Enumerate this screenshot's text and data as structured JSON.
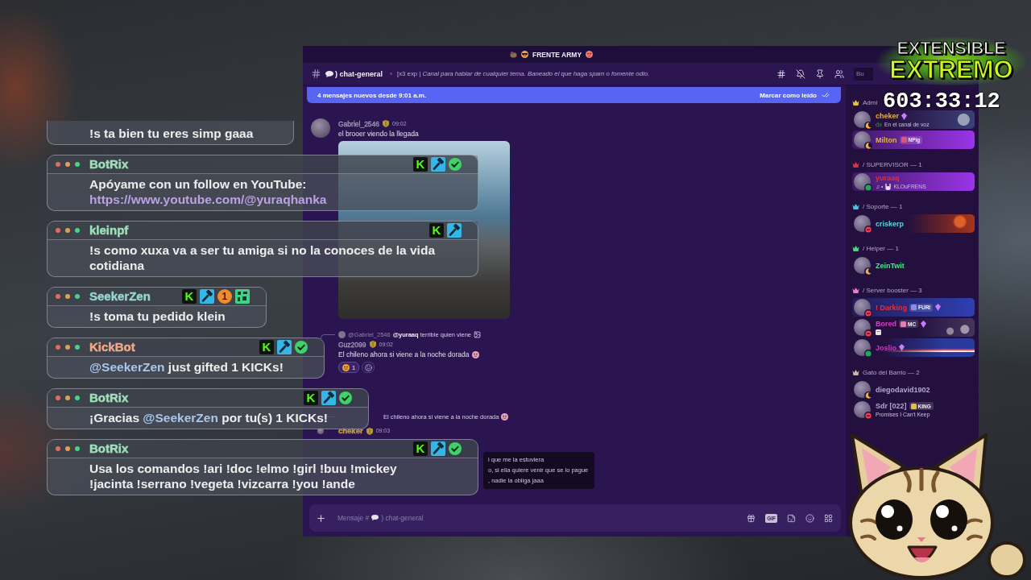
{
  "logo": {
    "lines": [
      "EXTENSIBLE",
      "EXTREMO"
    ]
  },
  "timer": "603:33:12",
  "stream_chat": [
    {
      "text": [
        {
          "kind": "plain",
          "text": "!s ta bien tu eres simp gaaa"
        }
      ]
    },
    {
      "user": "BotRix",
      "color": "#9fe0bb",
      "badges": [
        {
          "kind": "kick",
          "label": "K"
        },
        {
          "kind": "mod"
        },
        {
          "kind": "verified"
        }
      ],
      "text": [
        {
          "kind": "plain",
          "text": "Apóyame con un follow en YouTube:"
        },
        {
          "kind": "link",
          "text": "https://www.youtube.com/@yuraqhanka"
        }
      ]
    },
    {
      "user": "kleinpf",
      "color": "#9fe0bb",
      "badges": [
        {
          "kind": "kick",
          "label": "K"
        },
        {
          "kind": "mod"
        }
      ],
      "text": [
        {
          "kind": "plain",
          "text": "!s como xuxa va a ser tu amiga si no la conoces de la vida cotidiana"
        }
      ]
    },
    {
      "user": "SeekerZen",
      "color": "#97d6cf",
      "badges": [
        {
          "kind": "kick",
          "label": "K"
        },
        {
          "kind": "mod"
        },
        {
          "kind": "coin",
          "label": "1"
        },
        {
          "kind": "pixel"
        }
      ],
      "text": [
        {
          "kind": "plain",
          "text": "!s toma tu pedido klein"
        }
      ]
    },
    {
      "user": "KickBot",
      "color": "#f0a98a",
      "badges": [
        {
          "kind": "kick",
          "label": "K"
        },
        {
          "kind": "mod"
        },
        {
          "kind": "verified"
        }
      ],
      "text": [
        {
          "kind": "mention",
          "text": "@SeekerZen"
        },
        {
          "kind": "plain",
          "text": " just gifted 1 KICKs!"
        }
      ]
    },
    {
      "user": "BotRix",
      "color": "#9fe0bb",
      "badges": [
        {
          "kind": "kick",
          "label": "K"
        },
        {
          "kind": "mod"
        },
        {
          "kind": "verified"
        }
      ],
      "text": [
        {
          "kind": "plain",
          "text": "¡Gracias "
        },
        {
          "kind": "mention",
          "text": "@SeekerZen"
        },
        {
          "kind": "plain",
          "text": " por tu(s) 1 KICKs!"
        }
      ]
    },
    {
      "user": "BotRix",
      "color": "#9fe0bb",
      "badges": [
        {
          "kind": "kick",
          "label": "K"
        },
        {
          "kind": "mod"
        },
        {
          "kind": "verified"
        }
      ],
      "text": [
        {
          "kind": "plain",
          "text": "Usa los comandos !ari !doc !elmo !girl !buu !mickey !jacinta !serrano !vegeta !vizcarra !you !ande"
        }
      ]
    }
  ],
  "discord": {
    "server": {
      "title": "FRENTE ARMY"
    },
    "channel": {
      "name": ") chat-general",
      "topic": "[x3 exp | *Canal para hablar de cualquier tema. Baneado el que haga spam o fomente odio.*"
    },
    "search": {
      "placeholder": "Bu"
    },
    "new_messages": {
      "text": "4 mensajes nuevos desde 9:01 a.m.",
      "action": "Marcar como leído"
    },
    "messages": [
      {
        "author": "Gabriel_2546",
        "color": "#a79cbb",
        "avatar": true,
        "time": "09:02",
        "text": "el brooer viendo la llegada",
        "emoji": false,
        "attachment": {
          "kind": "photo"
        }
      },
      {
        "reply": {
          "author": "@Gabriel_2546",
          "text": "**@yuraaq** terrible quien viene",
          "image": true,
          "emoji": false
        },
        "author": "Guz2099",
        "color": "#a79cbb",
        "avatar": false,
        "time": "09:02",
        "text": "El chileno ahora si viene a la noche dorada",
        "emoji": true,
        "reactions": [
          {
            "count": "1"
          }
        ]
      },
      {
        "reply": {
          "text": "El chileno ahora si viene a la noche dorada",
          "image": false,
          "emoji": true
        },
        "author": "cheker",
        "color": "#c29d3c",
        "avatar": true,
        "time": "09:03",
        "embed_lines": [
          "i que me la estuviera",
          "o, si ella quiere venir que se lo pague",
          ", nadie la obliga jaaa"
        ]
      }
    ],
    "composer": {
      "placeholder": [
        "Mensaje #",
        ") chat-general"
      ],
      "gif": "GIF"
    },
    "member_groups": [
      {
        "title": "Admi",
        "color": "#e8c13a",
        "members": [
          {
            "name": "cheker",
            "color": "#e3b341",
            "status": {
              "kind": "idle"
            },
            "boosting": true,
            "nameplate": {
              "kind": "moon"
            },
            "subtitle": {
              "kind": "voice",
              "text": "En el canal de voz"
            }
          },
          {
            "name": "Milton",
            "color": "#e3b341",
            "status": {
              "kind": "idle"
            },
            "boosting": false,
            "nameplate": {
              "kind": "violet"
            },
            "tag": {
              "label": "NPig",
              "color": "#e0557a"
            }
          }
        ]
      },
      {
        "title": "/ SUPERVISOR — 1",
        "color": "#e0303a",
        "members": [
          {
            "name": "yuraaq",
            "color": "#e0303a",
            "status": {
              "kind": "online"
            },
            "boosting": false,
            "nameplate": {
              "kind": "violet"
            },
            "subtitle": {
              "kind": "activity",
              "prefix": "♫ •",
              "text": "KLOuFRENS"
            }
          }
        ]
      },
      {
        "title": "/ Soporte — 1",
        "color": "#3ec7e0",
        "members": [
          {
            "name": "criskerp",
            "color": "#5fd3e0",
            "status": {
              "kind": "dnd"
            },
            "boosting": false,
            "nameplate": {
              "kind": "fire"
            }
          }
        ]
      },
      {
        "title": "/ Helper — 1",
        "color": "#3ee07a",
        "members": [
          {
            "name": "ZeinTwit",
            "color": "#4ee08a",
            "status": {
              "kind": "idle"
            },
            "boosting": false
          }
        ]
      },
      {
        "title": "/ Server booster — 3",
        "color": "#f07ad0",
        "members": [
          {
            "name": "! Darking",
            "color": "#e0303a",
            "status": {
              "kind": "dnd"
            },
            "boosting": true,
            "nameplate": {
              "kind": "ocean"
            },
            "tag": {
              "label": "FURI",
              "color": "#8a8cf0"
            }
          },
          {
            "name": "Bored",
            "color": "#d63fbf",
            "status": {
              "kind": "dnd"
            },
            "boosting": true,
            "nameplate": {
              "kind": "flowers"
            },
            "tag": {
              "label": "MC",
              "color": "#f07ab0"
            },
            "subtitle": {
              "kind": "emoji"
            }
          },
          {
            "name": "Joslio",
            "color": "#c03fc0",
            "status": {
              "kind": "online"
            },
            "boosting": true,
            "nameplate": {
              "kind": "stripes"
            }
          }
        ]
      },
      {
        "title": "Gato del Barrio — 2",
        "color": "#c8b89a",
        "members": [
          {
            "name": "diegodavid1902",
            "color": "#b3a6cf",
            "status": {
              "kind": "idle"
            },
            "boosting": false
          },
          {
            "name": "Sdr [022]",
            "color": "#b3a6cf",
            "status": {
              "kind": "dnd"
            },
            "boosting": false,
            "tag": {
              "label": "KING",
              "color": "#e6c030"
            },
            "subtitle": {
              "kind": "status",
              "text": "Promises I Can't Keep"
            }
          }
        ]
      }
    ]
  }
}
